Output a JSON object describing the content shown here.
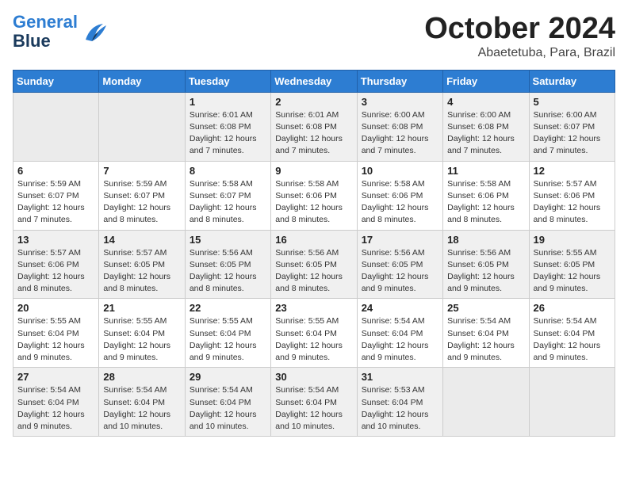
{
  "header": {
    "logo_line1": "General",
    "logo_line2": "Blue",
    "month_title": "October 2024",
    "subtitle": "Abaetetuba, Para, Brazil"
  },
  "weekdays": [
    "Sunday",
    "Monday",
    "Tuesday",
    "Wednesday",
    "Thursday",
    "Friday",
    "Saturday"
  ],
  "weeks": [
    [
      {
        "day": "",
        "info": ""
      },
      {
        "day": "",
        "info": ""
      },
      {
        "day": "1",
        "info": "Sunrise: 6:01 AM\nSunset: 6:08 PM\nDaylight: 12 hours and 7 minutes."
      },
      {
        "day": "2",
        "info": "Sunrise: 6:01 AM\nSunset: 6:08 PM\nDaylight: 12 hours and 7 minutes."
      },
      {
        "day": "3",
        "info": "Sunrise: 6:00 AM\nSunset: 6:08 PM\nDaylight: 12 hours and 7 minutes."
      },
      {
        "day": "4",
        "info": "Sunrise: 6:00 AM\nSunset: 6:08 PM\nDaylight: 12 hours and 7 minutes."
      },
      {
        "day": "5",
        "info": "Sunrise: 6:00 AM\nSunset: 6:07 PM\nDaylight: 12 hours and 7 minutes."
      }
    ],
    [
      {
        "day": "6",
        "info": "Sunrise: 5:59 AM\nSunset: 6:07 PM\nDaylight: 12 hours and 7 minutes."
      },
      {
        "day": "7",
        "info": "Sunrise: 5:59 AM\nSunset: 6:07 PM\nDaylight: 12 hours and 8 minutes."
      },
      {
        "day": "8",
        "info": "Sunrise: 5:58 AM\nSunset: 6:07 PM\nDaylight: 12 hours and 8 minutes."
      },
      {
        "day": "9",
        "info": "Sunrise: 5:58 AM\nSunset: 6:06 PM\nDaylight: 12 hours and 8 minutes."
      },
      {
        "day": "10",
        "info": "Sunrise: 5:58 AM\nSunset: 6:06 PM\nDaylight: 12 hours and 8 minutes."
      },
      {
        "day": "11",
        "info": "Sunrise: 5:58 AM\nSunset: 6:06 PM\nDaylight: 12 hours and 8 minutes."
      },
      {
        "day": "12",
        "info": "Sunrise: 5:57 AM\nSunset: 6:06 PM\nDaylight: 12 hours and 8 minutes."
      }
    ],
    [
      {
        "day": "13",
        "info": "Sunrise: 5:57 AM\nSunset: 6:06 PM\nDaylight: 12 hours and 8 minutes."
      },
      {
        "day": "14",
        "info": "Sunrise: 5:57 AM\nSunset: 6:05 PM\nDaylight: 12 hours and 8 minutes."
      },
      {
        "day": "15",
        "info": "Sunrise: 5:56 AM\nSunset: 6:05 PM\nDaylight: 12 hours and 8 minutes."
      },
      {
        "day": "16",
        "info": "Sunrise: 5:56 AM\nSunset: 6:05 PM\nDaylight: 12 hours and 8 minutes."
      },
      {
        "day": "17",
        "info": "Sunrise: 5:56 AM\nSunset: 6:05 PM\nDaylight: 12 hours and 9 minutes."
      },
      {
        "day": "18",
        "info": "Sunrise: 5:56 AM\nSunset: 6:05 PM\nDaylight: 12 hours and 9 minutes."
      },
      {
        "day": "19",
        "info": "Sunrise: 5:55 AM\nSunset: 6:05 PM\nDaylight: 12 hours and 9 minutes."
      }
    ],
    [
      {
        "day": "20",
        "info": "Sunrise: 5:55 AM\nSunset: 6:04 PM\nDaylight: 12 hours and 9 minutes."
      },
      {
        "day": "21",
        "info": "Sunrise: 5:55 AM\nSunset: 6:04 PM\nDaylight: 12 hours and 9 minutes."
      },
      {
        "day": "22",
        "info": "Sunrise: 5:55 AM\nSunset: 6:04 PM\nDaylight: 12 hours and 9 minutes."
      },
      {
        "day": "23",
        "info": "Sunrise: 5:55 AM\nSunset: 6:04 PM\nDaylight: 12 hours and 9 minutes."
      },
      {
        "day": "24",
        "info": "Sunrise: 5:54 AM\nSunset: 6:04 PM\nDaylight: 12 hours and 9 minutes."
      },
      {
        "day": "25",
        "info": "Sunrise: 5:54 AM\nSunset: 6:04 PM\nDaylight: 12 hours and 9 minutes."
      },
      {
        "day": "26",
        "info": "Sunrise: 5:54 AM\nSunset: 6:04 PM\nDaylight: 12 hours and 9 minutes."
      }
    ],
    [
      {
        "day": "27",
        "info": "Sunrise: 5:54 AM\nSunset: 6:04 PM\nDaylight: 12 hours and 9 minutes."
      },
      {
        "day": "28",
        "info": "Sunrise: 5:54 AM\nSunset: 6:04 PM\nDaylight: 12 hours and 10 minutes."
      },
      {
        "day": "29",
        "info": "Sunrise: 5:54 AM\nSunset: 6:04 PM\nDaylight: 12 hours and 10 minutes."
      },
      {
        "day": "30",
        "info": "Sunrise: 5:54 AM\nSunset: 6:04 PM\nDaylight: 12 hours and 10 minutes."
      },
      {
        "day": "31",
        "info": "Sunrise: 5:53 AM\nSunset: 6:04 PM\nDaylight: 12 hours and 10 minutes."
      },
      {
        "day": "",
        "info": ""
      },
      {
        "day": "",
        "info": ""
      }
    ]
  ]
}
